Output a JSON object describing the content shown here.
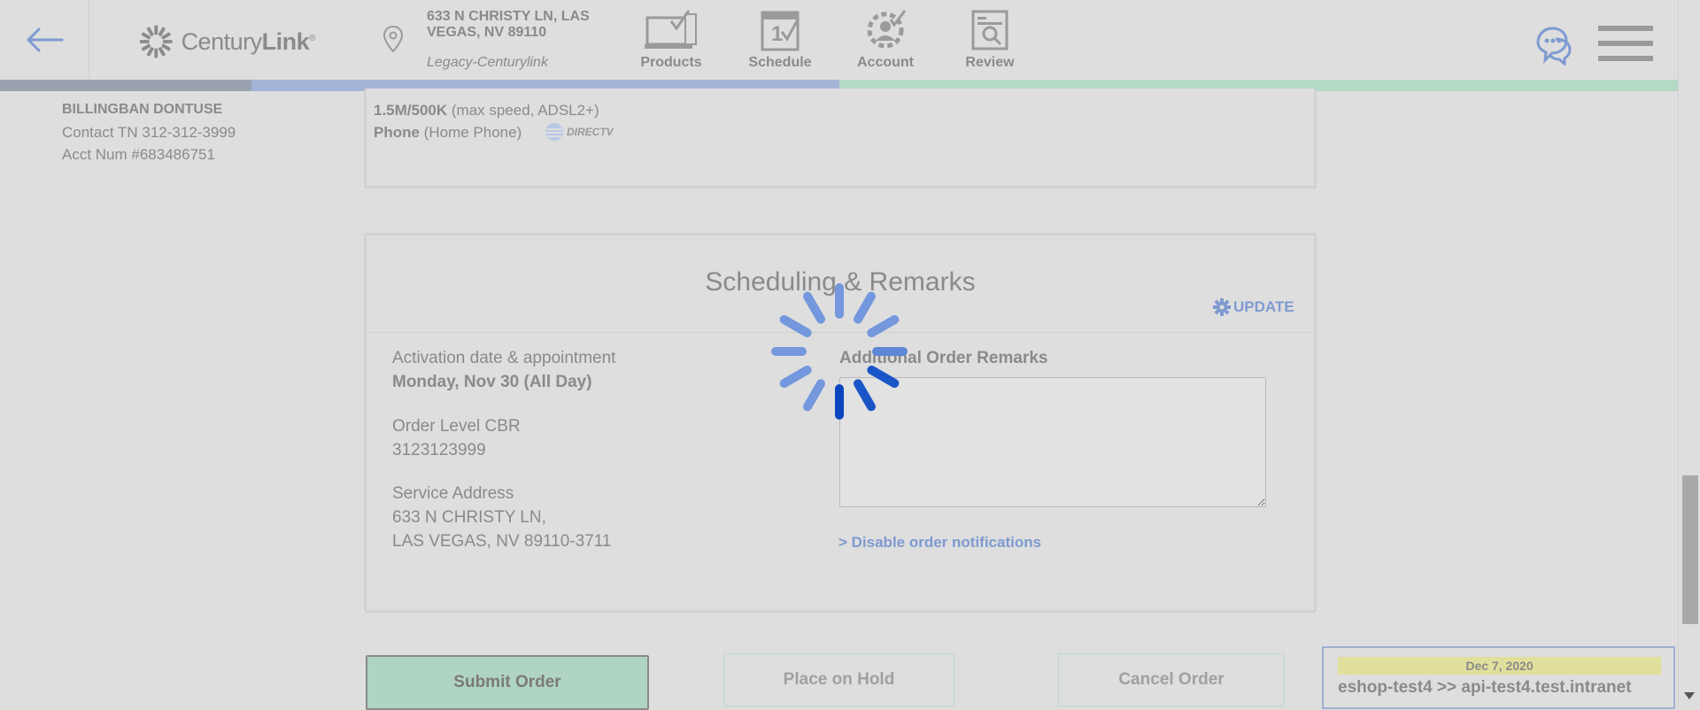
{
  "header": {
    "brand": {
      "name_part1": "Century",
      "name_part2": "Link",
      "mark": "®"
    },
    "address_line": "633 N CHRISTY LN, LAS VEGAS, NV 89110",
    "account_type": "Legacy-Centurylink",
    "nav": [
      {
        "label": "Products",
        "icon": "products-icon"
      },
      {
        "label": "Schedule",
        "icon": "schedule-icon"
      },
      {
        "label": "Account",
        "icon": "account-icon"
      },
      {
        "label": "Review",
        "icon": "review-icon"
      }
    ]
  },
  "progress": {
    "colors": [
      "#9aa2b0",
      "#a3b4d6",
      "#b4d9c5"
    ]
  },
  "customer": {
    "name": "BILLINGBAN DONTUSE",
    "contact": "Contact TN 312-312-3999",
    "account": "Acct Num #683486751"
  },
  "products": {
    "internet_bold": "1.5M/500K",
    "internet_detail": " (max speed, ADSL2+)",
    "phone_bold": "Phone",
    "phone_detail": " (Home Phone)",
    "partner": "DIRECTV"
  },
  "scheduling": {
    "title": "Scheduling & Remarks",
    "update_label": "UPDATE",
    "activation_label": "Activation date & appointment",
    "activation_value": "Monday, Nov 30 (All Day)",
    "cbr_label": "Order Level CBR",
    "cbr_value": "3123123999",
    "service_label": "Service Address",
    "service_line1": "633 N CHRISTY LN,",
    "service_line2": "LAS VEGAS, NV 89110-3711",
    "remarks_label": "Additional Order Remarks",
    "remarks_value": "",
    "disable_link": "> Disable order notifications"
  },
  "actions": {
    "submit": "Submit Order",
    "hold": "Place on Hold",
    "cancel": "Cancel Order"
  },
  "env": {
    "date": "Dec 7, 2020",
    "text": "eshop-test4 >> api-test4.test.intranet"
  },
  "colors": {
    "accent_blue": "#7e9ad0",
    "spinner": "#1a55c8",
    "submit_green": "#b0d4c2",
    "env_yellow": "#e0e09c"
  }
}
